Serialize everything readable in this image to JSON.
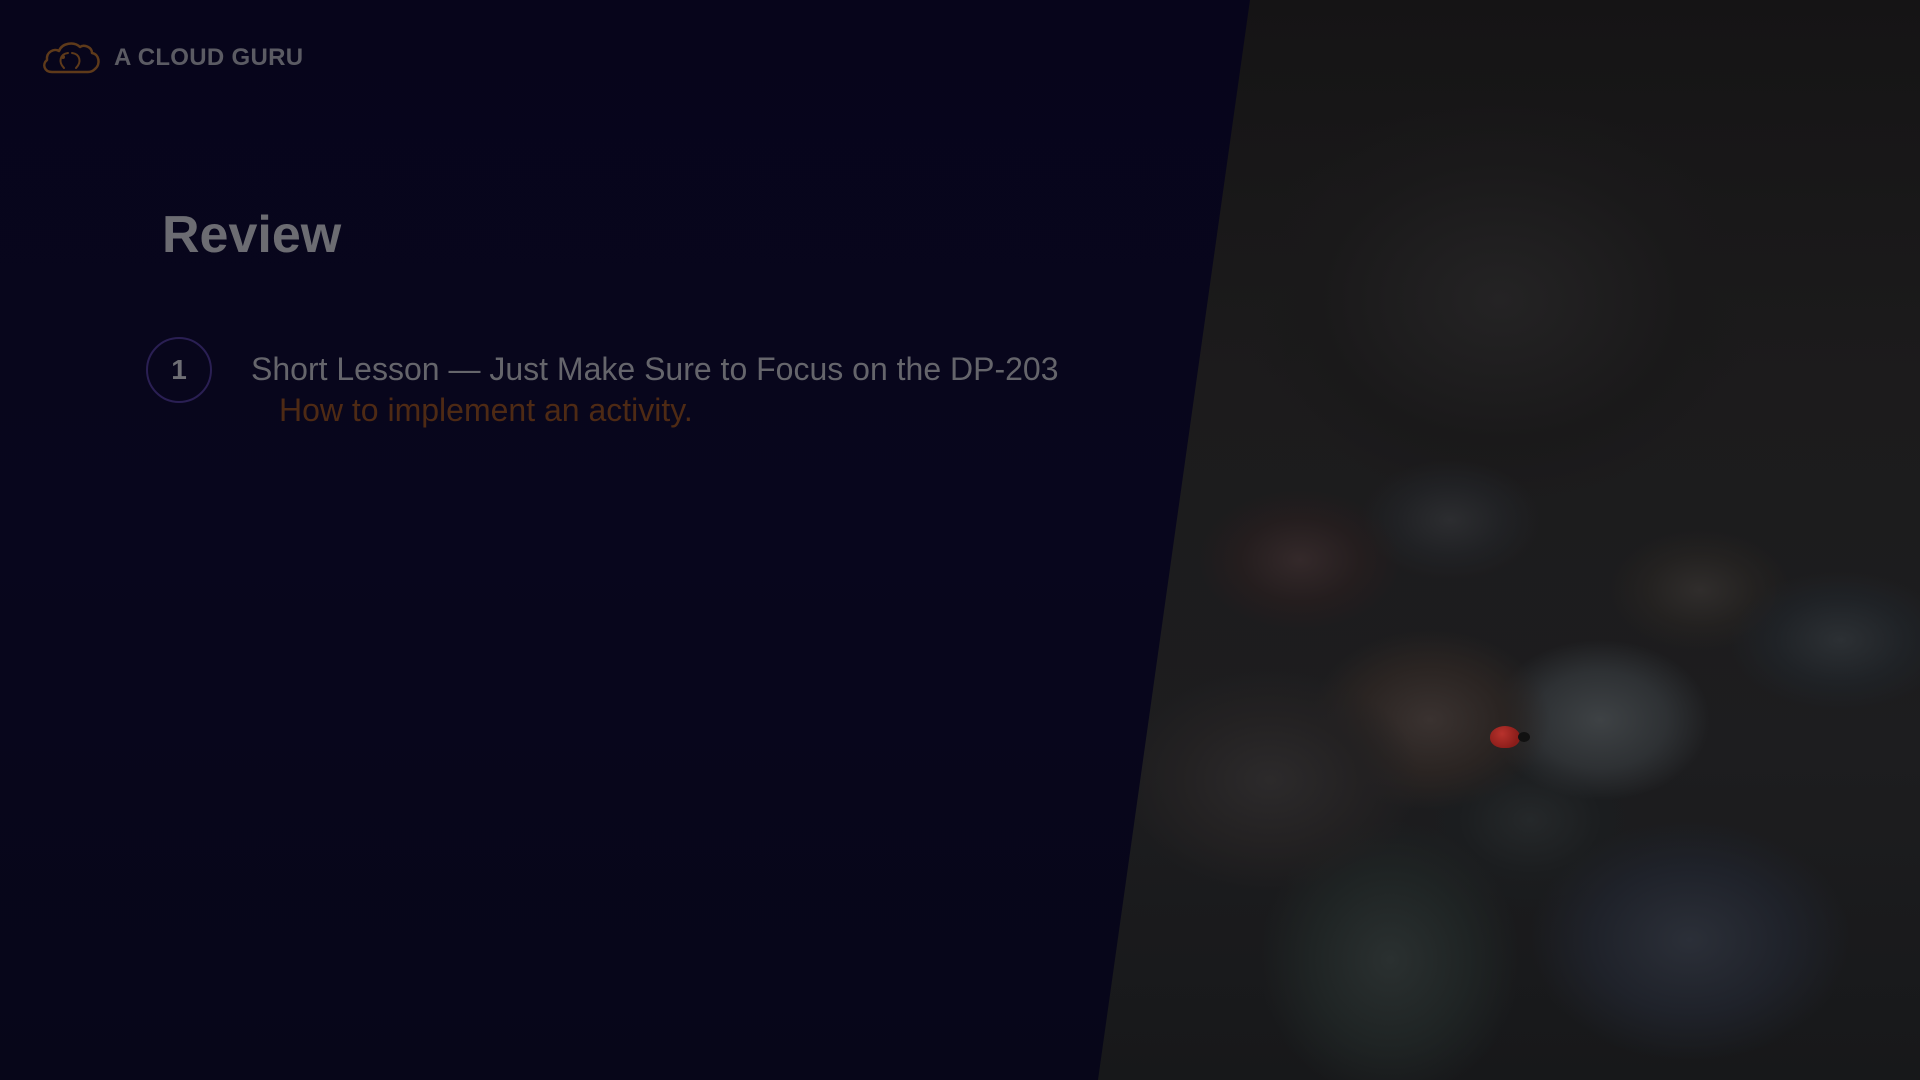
{
  "brand": {
    "name": "A CLOUD GURU",
    "icon": "cloud-logo-icon",
    "accent_color": "#e8741e"
  },
  "slide": {
    "title": "Review",
    "items": [
      {
        "number": "1",
        "title": "Short Lesson — Just Make Sure to Focus on the DP-203",
        "subtitle": "How to implement an activity."
      }
    ]
  },
  "colors": {
    "panel": "#07051b",
    "title_text": "#6c6c72",
    "subtitle_text": "#4e2a14",
    "circle_border": "#2a1f53"
  },
  "background_photo": {
    "subject": "pebbles with ladybug"
  }
}
